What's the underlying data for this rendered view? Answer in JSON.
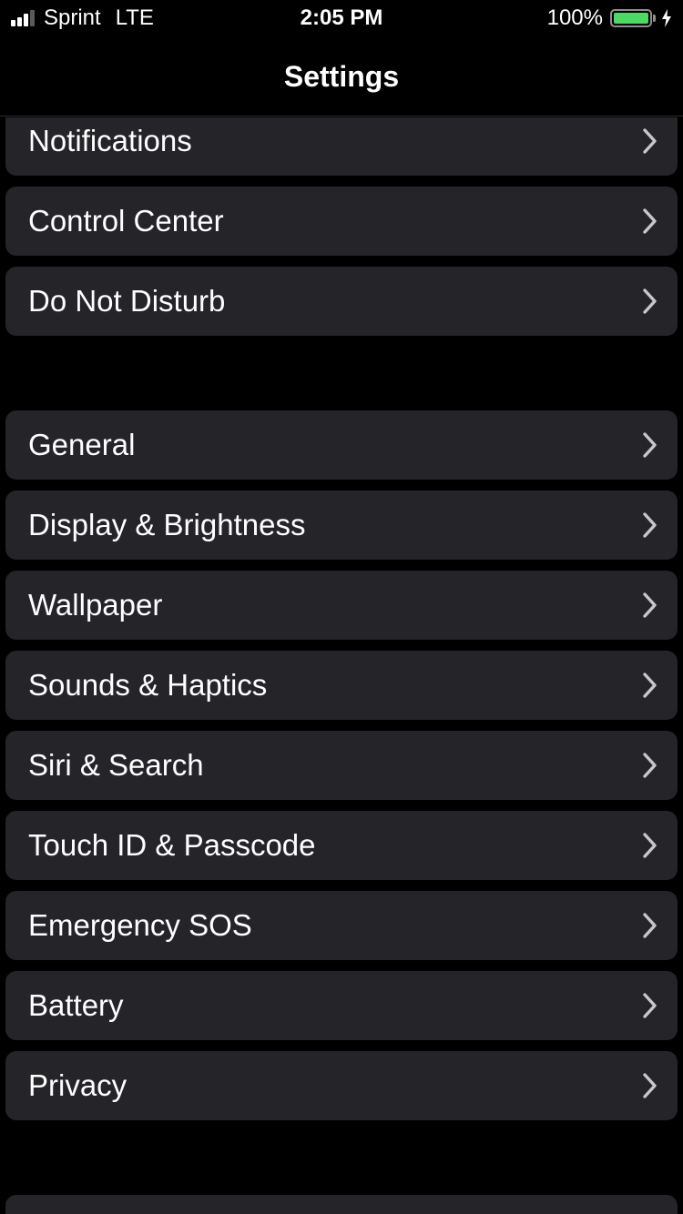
{
  "colors": {
    "background": "#000000",
    "cell": "#242429",
    "text": "#ffffff",
    "chevron": "#c7c7cc",
    "battery_green": "#4cd964"
  },
  "status_bar": {
    "carrier": "Sprint",
    "network": "LTE",
    "time": "2:05 PM",
    "battery_percent": "100%",
    "battery_level": 1.0,
    "signal_bars_filled": 3,
    "signal_bars_total": 4,
    "charging": true
  },
  "nav": {
    "title": "Settings"
  },
  "settings": {
    "group1": [
      {
        "label": "Notifications",
        "icon": "chevron-right-icon"
      },
      {
        "label": "Control Center",
        "icon": "chevron-right-icon"
      },
      {
        "label": "Do Not Disturb",
        "icon": "chevron-right-icon"
      }
    ],
    "group2": [
      {
        "label": "General",
        "icon": "chevron-right-icon"
      },
      {
        "label": "Display & Brightness",
        "icon": "chevron-right-icon"
      },
      {
        "label": "Wallpaper",
        "icon": "chevron-right-icon"
      },
      {
        "label": "Sounds & Haptics",
        "icon": "chevron-right-icon"
      },
      {
        "label": "Siri & Search",
        "icon": "chevron-right-icon"
      },
      {
        "label": "Touch ID & Passcode",
        "icon": "chevron-right-icon"
      },
      {
        "label": "Emergency SOS",
        "icon": "chevron-right-icon"
      },
      {
        "label": "Battery",
        "icon": "chevron-right-icon"
      },
      {
        "label": "Privacy",
        "icon": "chevron-right-icon"
      }
    ]
  }
}
